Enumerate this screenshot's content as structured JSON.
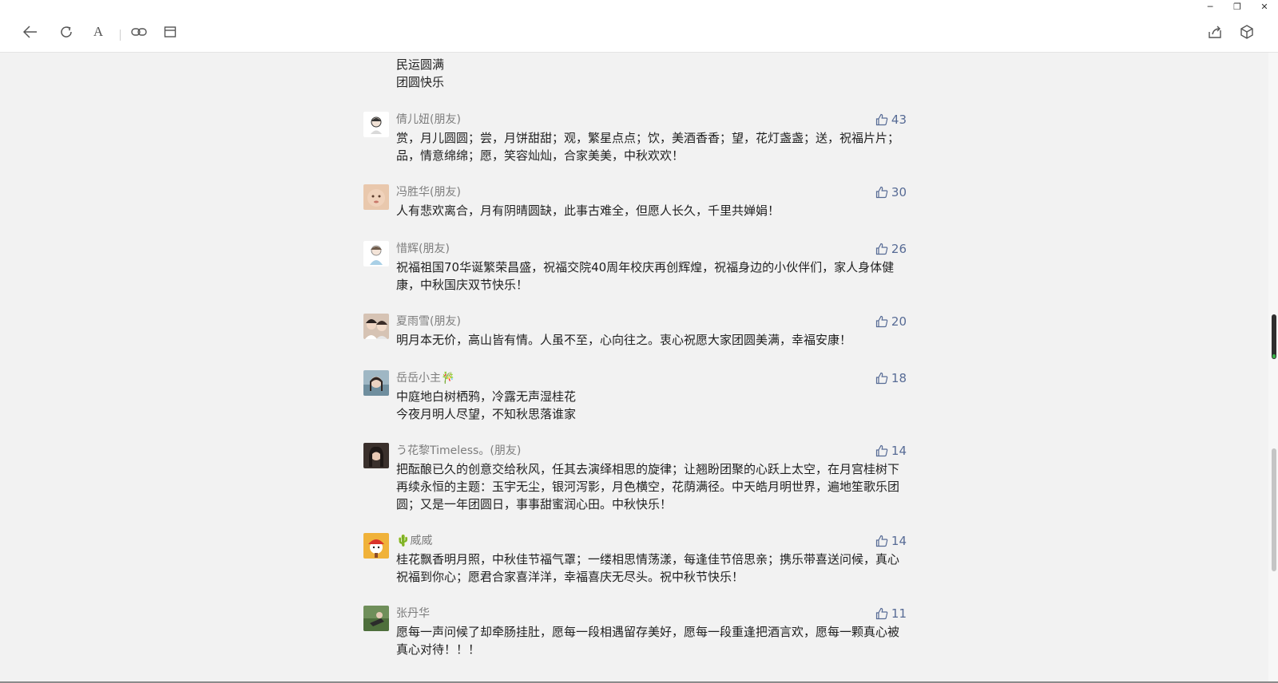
{
  "window": {
    "minimize": "─",
    "restore": "❐",
    "close": "✕"
  },
  "toolbar": {
    "back_icon": "back-arrow-icon",
    "refresh_icon": "refresh-icon",
    "font_label": "A",
    "link_icon": "link-icon",
    "window_icon": "window-icon",
    "share_icon": "share-icon",
    "cube_icon": "cube-icon"
  },
  "leading_text": [
    "民运圆满",
    "团圆快乐"
  ],
  "comments": [
    {
      "name": "倩儿妞(朋友)",
      "likes": "43",
      "text": "赏，月儿圆圆；尝，月饼甜甜；观，繁星点点；饮，美酒香香；望，花灯盏盏；送，祝福片片；品，情意绵绵；愿，笑容灿灿，合家美美，中秋欢欢！"
    },
    {
      "name": "冯胜华(朋友)",
      "likes": "30",
      "text": "人有悲欢离合，月有阴晴圆缺，此事古难全，但愿人长久，千里共婵娟！"
    },
    {
      "name": "惜辉(朋友)",
      "likes": "26",
      "text": "祝福祖国70华诞繁荣昌盛，祝福交院40周年校庆再创辉煌，祝福身边的小伙伴们，家人身体健康，中秋国庆双节快乐！"
    },
    {
      "name": "夏雨雪(朋友)",
      "likes": "20",
      "text": "明月本无价，高山皆有情。人虽不至，心向往之。衷心祝愿大家团圆美满，幸福安康！"
    },
    {
      "name": "岳岳小主🎋",
      "likes": "18",
      "text": "中庭地白树栖鸦，冷露无声湿桂花\n今夜月明人尽望，不知秋思落谁家"
    },
    {
      "name": "う花黎Timeless。(朋友)",
      "likes": "14",
      "text": "把酝酿已久的创意交给秋风，任其去演绎相思的旋律；让翘盼团聚的心跃上太空，在月宫桂树下再续永恒的主题：玉宇无尘，银河泻影，月色横空，花荫满径。中天皓月明世界，遍地笙歌乐团圆；又是一年团圆日，事事甜蜜润心田。中秋快乐！"
    },
    {
      "name": "🌵威威",
      "likes": "14",
      "text": "桂花飘香明月照，中秋佳节福气罩；一缕相思情荡漾，每逢佳节倍思亲；携乐带喜送问候，真心祝福到你心；愿君合家喜洋洋，幸福喜庆无尽头。祝中秋节快乐！"
    },
    {
      "name": "张丹华",
      "likes": "11",
      "text": "愿每一声问候了却牵肠挂肚，愿每一段相遇留存美好，愿每一段重逢把酒言欢，愿每一颗真心被真心对待！！！"
    }
  ],
  "colors": {
    "like": "#576b95",
    "name": "#7d7d7d",
    "background": "#f2f2f2"
  }
}
